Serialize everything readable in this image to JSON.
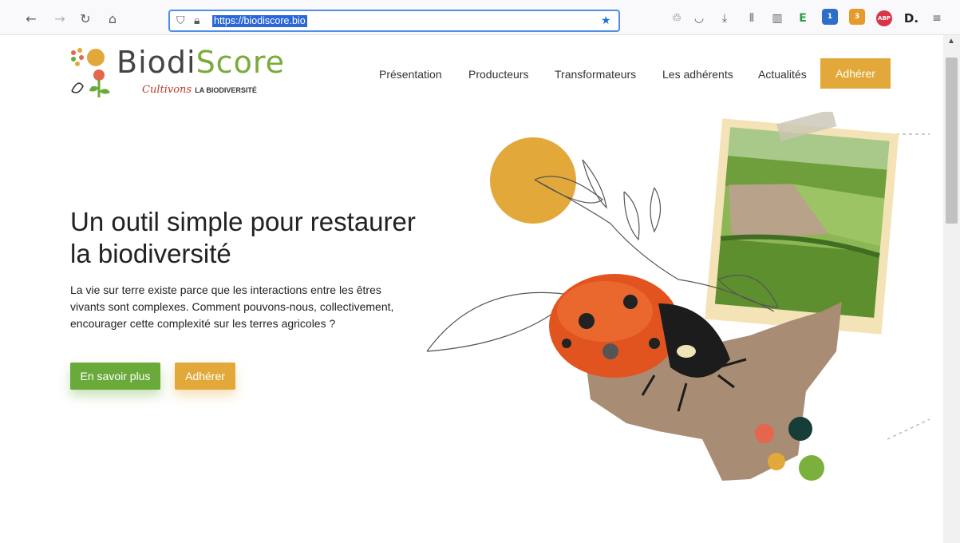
{
  "browser": {
    "url": "https://biodiscore.bio",
    "nav_icons": [
      "back-icon",
      "forward-icon",
      "reload-icon",
      "home-icon"
    ],
    "ext_badges": [
      "1",
      "3"
    ],
    "ext_abp": "ABP",
    "ext_d": "D."
  },
  "site": {
    "logo_word": "Biodi",
    "logo_word_accent": "Score",
    "logo_tag_script": "Cultivons",
    "logo_tag_caps": "LA BIODIVERSITÉ",
    "menu": [
      "Présentation",
      "Producteurs",
      "Transformateurs",
      "Les adhérents",
      "Actualités"
    ],
    "menu_cta": "Adhérer",
    "colors": {
      "accent": "#e2a93a",
      "green": "#6aaa3a",
      "coral": "#e5664d",
      "dark_teal": "#163d38"
    }
  },
  "hero": {
    "title": "Un outil simple pour restaurer la biodiversité",
    "lead": "La vie sur terre existe parce que les interactions entre les êtres vivants sont complexes. Comment pouvons-nous, collectivement, encourager cette complexité sur les terres agricoles ?",
    "btn_primary": "En savoir plus",
    "btn_secondary": "Adhérer"
  }
}
